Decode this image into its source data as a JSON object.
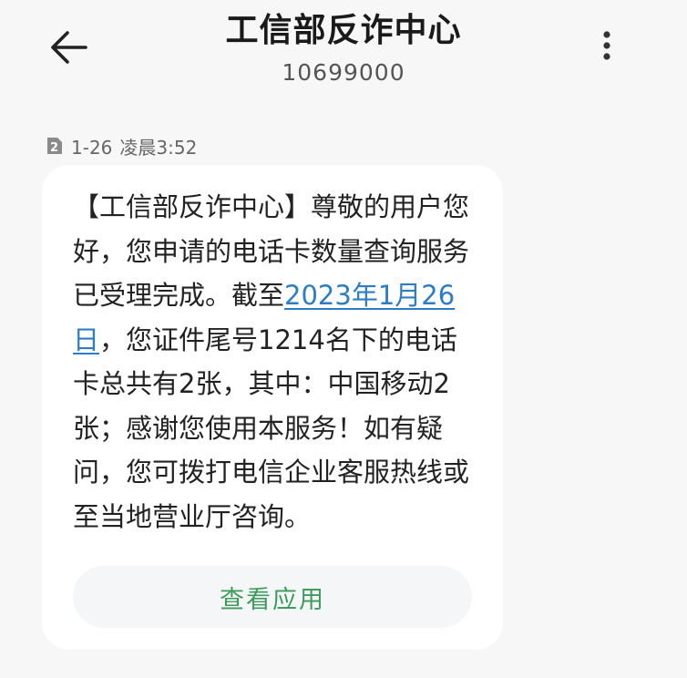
{
  "header": {
    "contact_name": "工信部反诈中心",
    "contact_number": "10699000",
    "back_icon": "arrow-left-icon",
    "more_icon": "more-vertical-icon"
  },
  "message": {
    "sim_slot": "2",
    "date": "1-26",
    "time": "凌晨3:52",
    "body_parts": {
      "p1": "【工信部反诈中心】尊敬的用户您好，您申请的电话卡数量查询服务已受理完成。截至",
      "date_link": "2023年1月26日",
      "p2": "，您证件尾号1214名下的电话卡总共有2张，其中：中国移动2张；感谢您使用本服务！如有疑问，您可拨打电信企业客服热线或至当地营业厅咨询。"
    },
    "action_label": "查看应用"
  },
  "colors": {
    "link": "#2d7cc7",
    "action_text": "#3d9b5c",
    "bubble_bg": "#ffffff",
    "page_bg": "#f7f7f7"
  }
}
